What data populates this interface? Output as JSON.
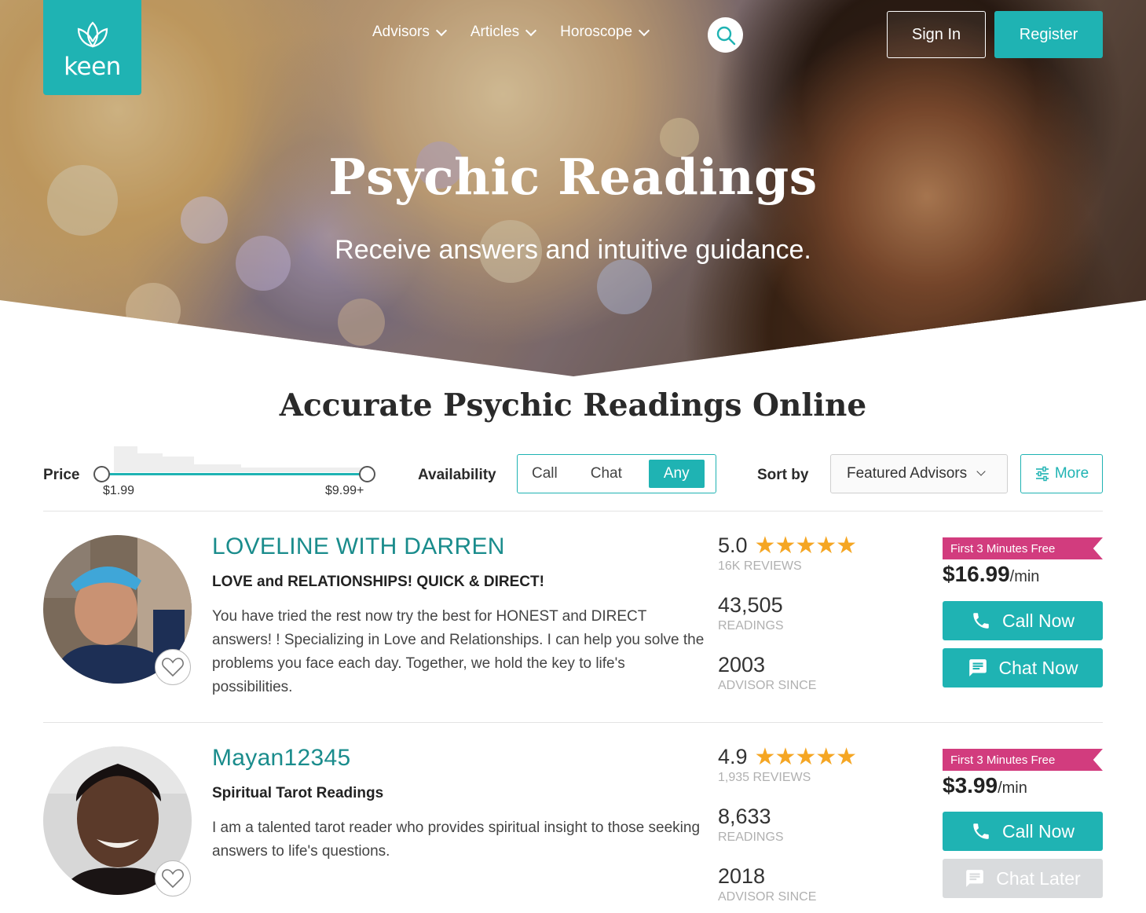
{
  "brand": {
    "name": "keen",
    "color": "#1fb3b3"
  },
  "nav": {
    "items": [
      {
        "label": "Advisors"
      },
      {
        "label": "Articles"
      },
      {
        "label": "Horoscope"
      }
    ],
    "search_icon": "search-icon",
    "sign_in": "Sign In",
    "register": "Register"
  },
  "hero": {
    "title": "Psychic Readings",
    "subtitle": "Receive answers and intuitive guidance."
  },
  "section_title": "Accurate Psychic Readings Online",
  "filters": {
    "price_label": "Price",
    "price_min": "$1.99",
    "price_max": "$9.99+",
    "availability_label": "Availability",
    "availability_options": [
      "Call",
      "Chat",
      "Any"
    ],
    "availability_selected": "Any",
    "sort_label": "Sort by",
    "sort_value": "Featured Advisors",
    "more_label": "More"
  },
  "advisors": [
    {
      "name": "LOVELINE WITH DARREN",
      "tagline": "LOVE and RELATIONSHIPS! QUICK & DIRECT!",
      "description": "You have tried the rest now try the best for HONEST and DIRECT answers! ! Specializing in Love and Relationships. I can help you solve the problems you face each day. Together, we hold the key to life's possibilities.",
      "rating": "5.0",
      "reviews": "16K REVIEWS",
      "readings": "43,505",
      "readings_label": "READINGS",
      "since": "2003",
      "since_label": "ADVISOR SINCE",
      "promo": "First 3 Minutes Free",
      "price": "$16.99",
      "price_unit": "/min",
      "primary_action": "Call Now",
      "secondary_action": "Chat Now",
      "secondary_available": true
    },
    {
      "name": "Mayan12345",
      "tagline": "Spiritual Tarot Readings",
      "description": "I am a talented tarot reader who provides spiritual insight to those seeking answers to life's questions.",
      "rating": "4.9",
      "reviews": "1,935 REVIEWS",
      "readings": "8,633",
      "readings_label": "READINGS",
      "since": "2018",
      "since_label": "ADVISOR SINCE",
      "promo": "First 3 Minutes Free",
      "price": "$3.99",
      "price_unit": "/min",
      "primary_action": "Call Now",
      "secondary_action": "Chat Later",
      "secondary_available": false
    }
  ]
}
